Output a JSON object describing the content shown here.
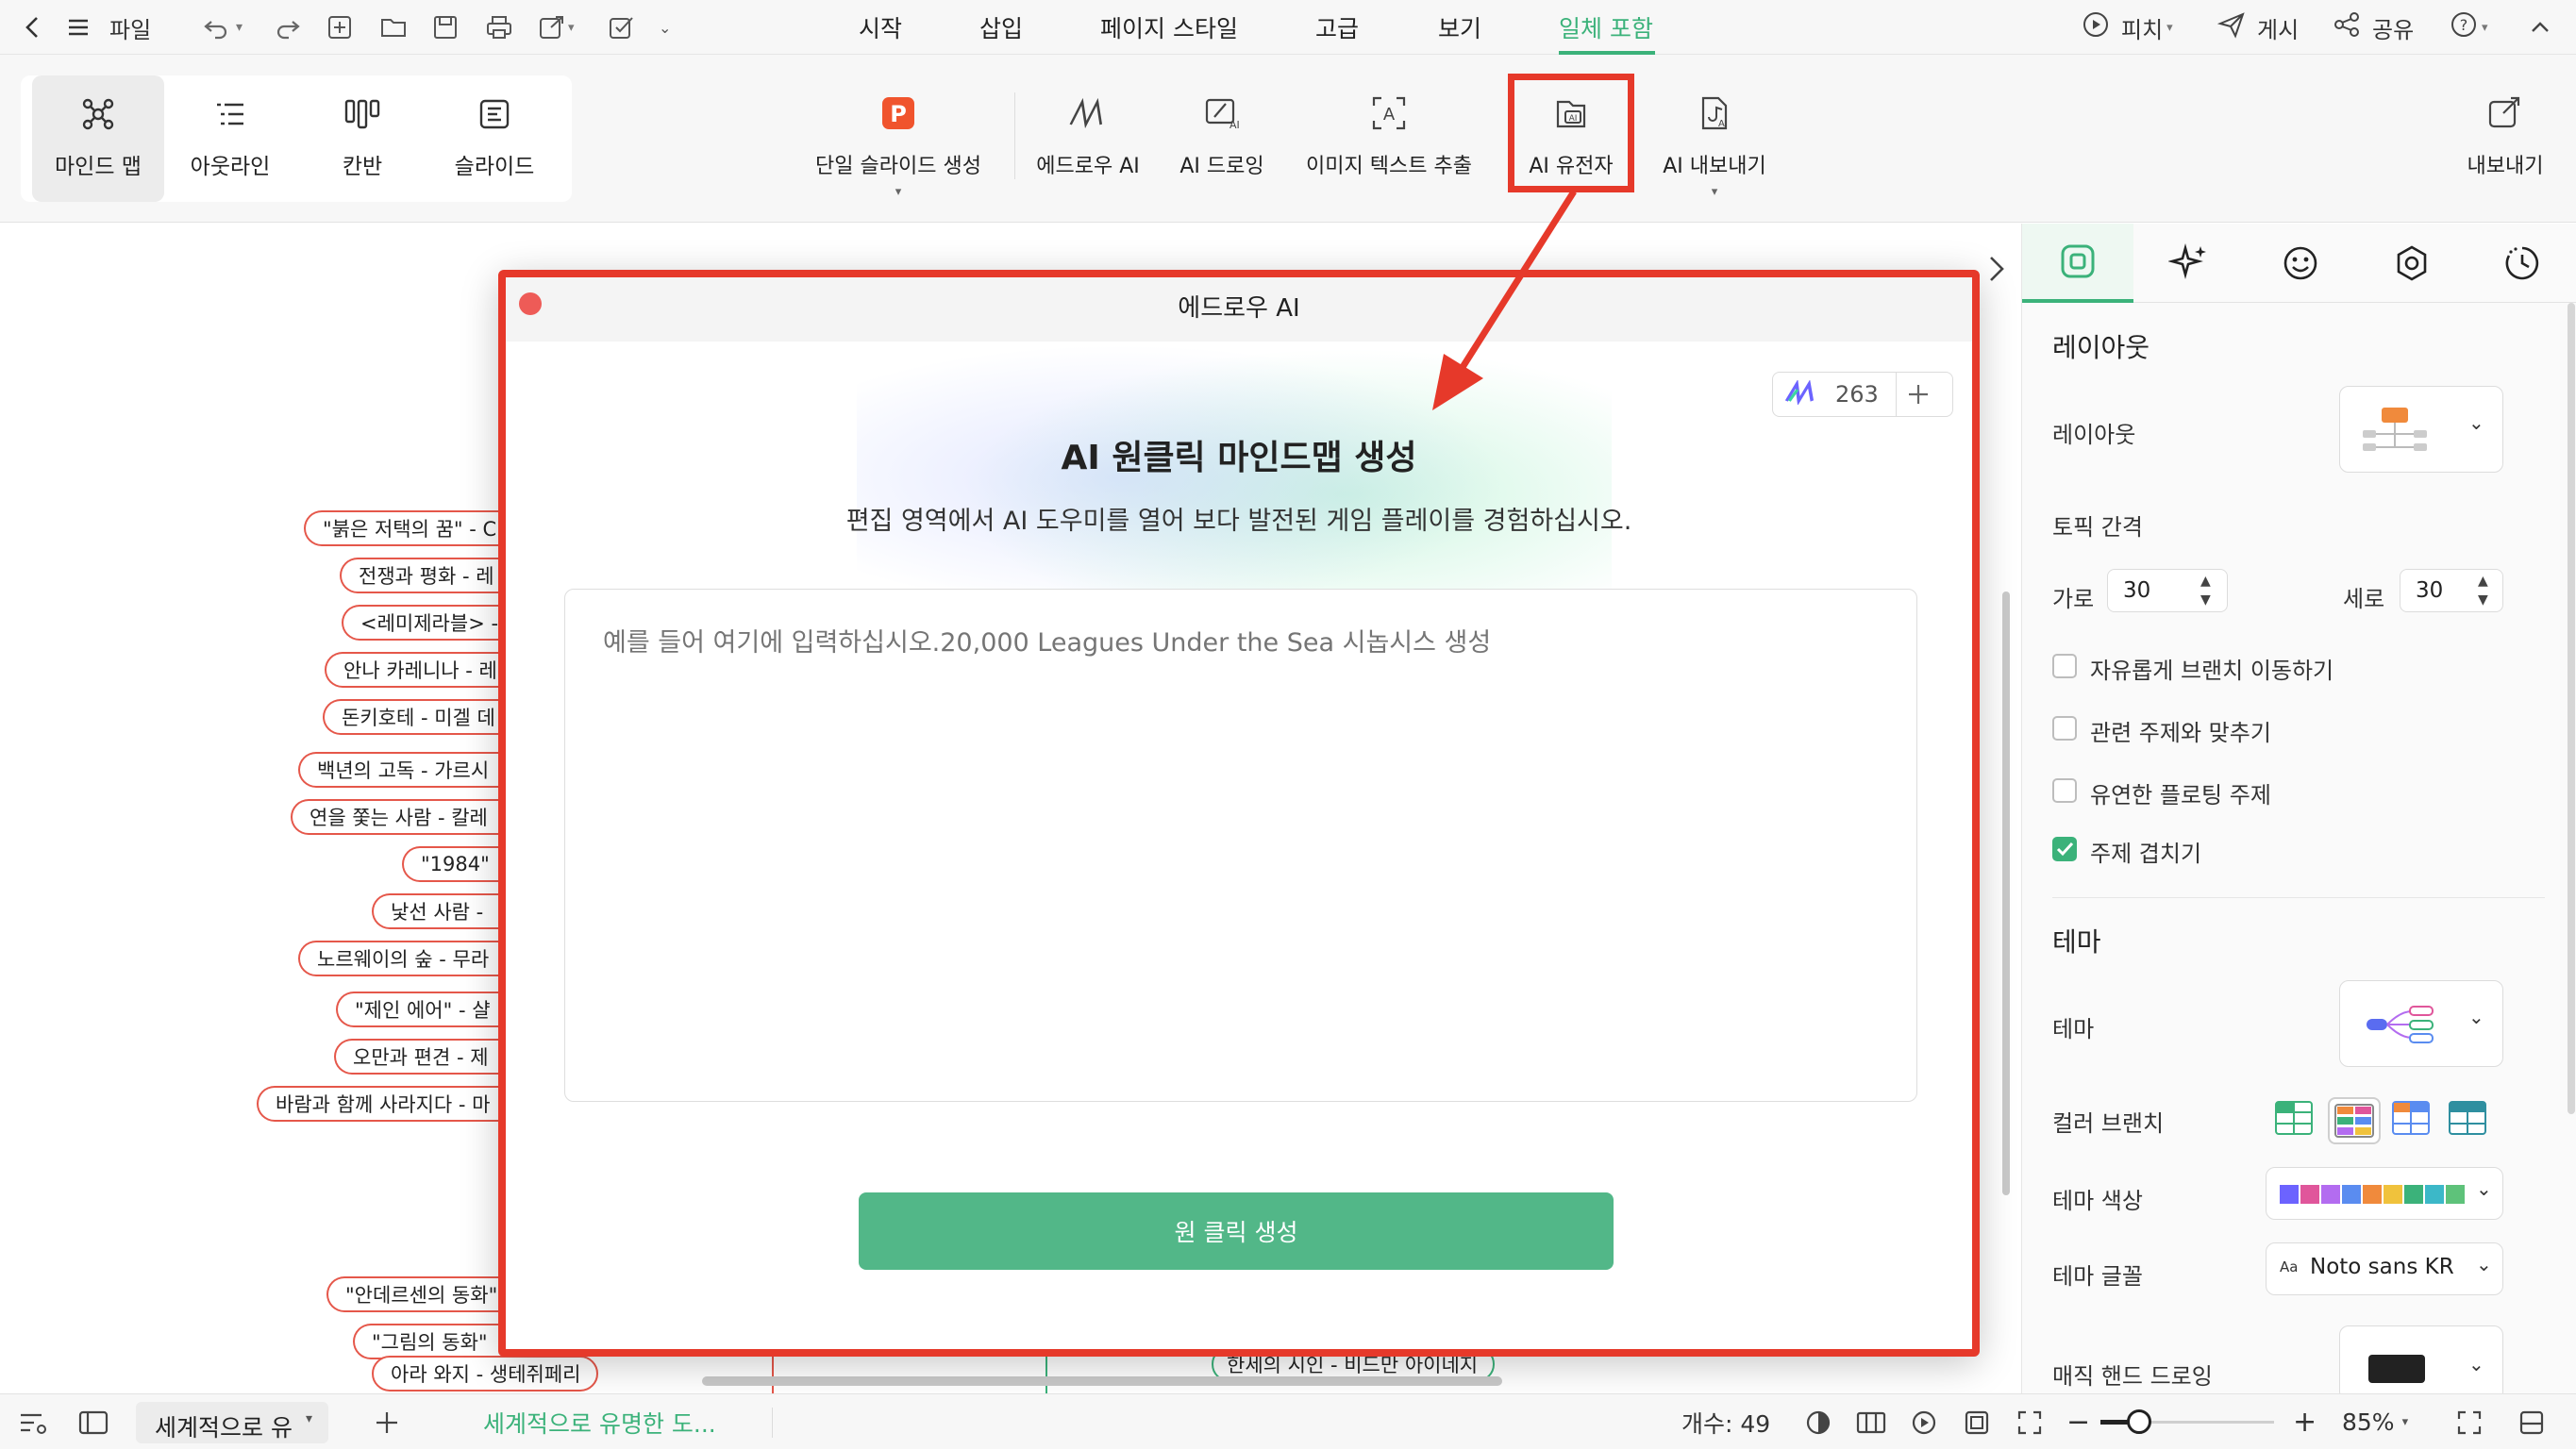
{
  "menubar": {
    "file_label": "파일",
    "tabs": [
      {
        "label": "시작"
      },
      {
        "label": "삽입"
      },
      {
        "label": "페이지 스타일"
      },
      {
        "label": "고급"
      },
      {
        "label": "보기"
      },
      {
        "label": "일체 포함",
        "active": true
      }
    ],
    "pitch_label": "피치",
    "post_label": "게시",
    "share_label": "공유"
  },
  "ribbon": {
    "views": [
      {
        "label": "마인드 맵",
        "active": true
      },
      {
        "label": "아웃라인"
      },
      {
        "label": "칸반"
      },
      {
        "label": "슬라이드"
      }
    ],
    "buttons": [
      {
        "label": "단일 슬라이드 생성"
      },
      {
        "label": "에드로우 AI"
      },
      {
        "label": "AI 드로잉"
      },
      {
        "label": "이미지 텍스트 추출"
      },
      {
        "label": "AI 유전자"
      },
      {
        "label": "AI 내보내기"
      }
    ],
    "export_label": "내보내기"
  },
  "canvas": {
    "nodes": [
      "\"붉은 저택의 꿈\" - C",
      "전쟁과 평화 - 레",
      "<레미제라블> -",
      "안나 카레니나 - 레",
      "돈키호테 - 미겔 데",
      "백년의 고독 - 가르시",
      "연을 쫓는 사람 - 칼레",
      "\"1984\"",
      "낯선 사람 -",
      "노르웨이의 숲 - 무라",
      "\"제인 에어\" - 샬",
      "오만과 편견 - 제",
      "바람과 함께 사라지다 - 마",
      "\"안데르센의 동화\"",
      "\"그림의 동화\"",
      "아라 와지 - 생테쥐페리"
    ],
    "bottom_node": "한세의 시인 - 비드만 아이네지"
  },
  "dialog": {
    "title": "에드로우 AI",
    "credits": "263",
    "heading": "AI 원클릭 마인드맵 생성",
    "subheading": "편집 영역에서 AI 도우미를 열어 보다 발전된 게임 플레이를 경험하십시오.",
    "input_placeholder": "예를 들어 여기에 입력하십시오.20,000 Leagues Under the Sea 시놉시스 생성",
    "generate_label": "원 클릭 생성",
    "generate_color": "#52b788"
  },
  "panel": {
    "layout_section": "레이아웃",
    "layout_label": "레이아웃",
    "topic_spacing_label": "토픽 간격",
    "horizontal_label": "가로",
    "horizontal_value": "30",
    "vertical_label": "세로",
    "vertical_value": "30",
    "options": [
      {
        "label": "자유롭게 브랜치 이동하기",
        "checked": false
      },
      {
        "label": "관련 주제와 맞추기",
        "checked": false
      },
      {
        "label": "유연한 플로팅 주제",
        "checked": false
      },
      {
        "label": "주제 겹치기",
        "checked": true
      }
    ],
    "theme_section": "테마",
    "theme_label": "테마",
    "color_branch_label": "컬러 브랜치",
    "theme_color_label": "테마 색상",
    "theme_font_label": "테마 글꼴",
    "theme_font_value": "Noto sans KR",
    "font_prefix": "Aa",
    "hand_drawing_label": "매직 핸드 드로잉",
    "palette": [
      "#6c63ff",
      "#e0569b",
      "#b36cf0",
      "#5a8cf0",
      "#f08a3c",
      "#f0c23c",
      "#3bb27a",
      "#3cb8c8",
      "#5ec27a"
    ]
  },
  "statusbar": {
    "tab_label": "세계적으로 유",
    "doc_label": "세계적으로 유명한 도...",
    "count_label": "개수: 49",
    "zoom_label": "85%"
  },
  "colors": {
    "accent": "#3bb27a",
    "highlight": "#e6392a",
    "node_border": "#e5574a"
  }
}
